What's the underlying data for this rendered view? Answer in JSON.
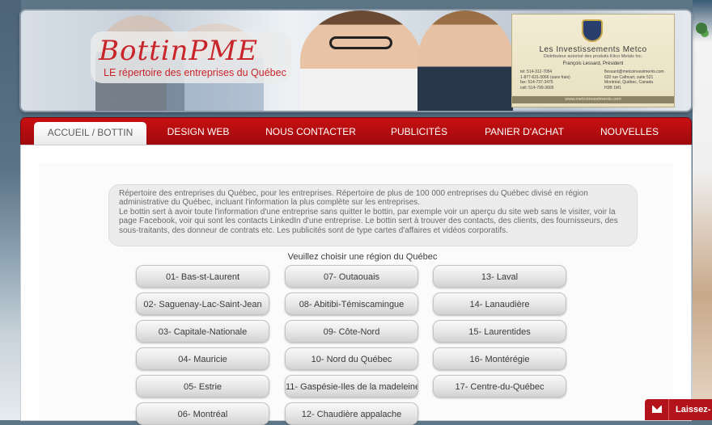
{
  "brand": {
    "name": "BottinPME",
    "tagline": "LE répertoire des entreprises du Québec"
  },
  "ad_card": {
    "company": "Les Investissements Metco",
    "subtitle": "Distributeur autorisé des produits Kitco Metals Inc.",
    "contact_name": "François Lessard, Président",
    "phones": [
      "tel: 514-312-7054",
      "1-877-631-0066 (sans frais)",
      "fax: 514-737-3475",
      "cell: 514-799-3605"
    ],
    "address": [
      "flessard@metcoinvestments.com",
      "620 rue Cathcart, suite 521",
      "Montréal, Québec, Canada",
      "H3B 1M1"
    ],
    "website": "www.metcoinvestments.com"
  },
  "nav": {
    "items": [
      "ACCUEIL / BOTTIN",
      "DESIGN WEB",
      "NOUS CONTACTER",
      "PUBLICITÉS",
      "PANIER D'ACHAT",
      "NOUVELLES"
    ],
    "active_index": 0
  },
  "intro": {
    "line1": "Répertoire des entreprises du Québec, pour les entreprises. Répertoire de plus de 100 000 entreprises du Québec divisé en région administrative du Québec, incluant l'information la plus complète sur les entreprises.",
    "line2": "Le bottin sert à avoir toute l'information d'une entreprise sans quitter le bottin, par exemple voir un aperçu du site web sans le visiter, voir la page Facebook, voir qui sont les contacts LinkedIn d'une entreprise. Le bottin sert à trouver des contacts, des clients, des fournisseurs, des sous-traitants, des donneur de contrats etc. Les publicités sont de type cartes d'affaires et vidéos corporatifs."
  },
  "regions": {
    "prompt": "Veuillez choisir une région du Québec",
    "items": [
      "01- Bas-st-Laurent",
      "02- Saguenay-Lac-Saint-Jean",
      "03- Capitale-Nationale",
      "04- Mauricie",
      "05- Estrie",
      "06- Montréal",
      "07- Outaouais",
      "08- Abitibi-Témiscamingue",
      "09- Côte-Nord",
      "10- Nord du Québec",
      "11- Gaspésie-Iles de la madeleine",
      "12- Chaudière appalache",
      "13- Laval",
      "14- Lanaudière",
      "15- Laurentides",
      "16- Montérégie",
      "17- Centre-du-Québec"
    ]
  },
  "chat": {
    "label": "Laissez-"
  },
  "colors": {
    "brand_red": "#c8242a",
    "nav_red": "#c80f12"
  }
}
